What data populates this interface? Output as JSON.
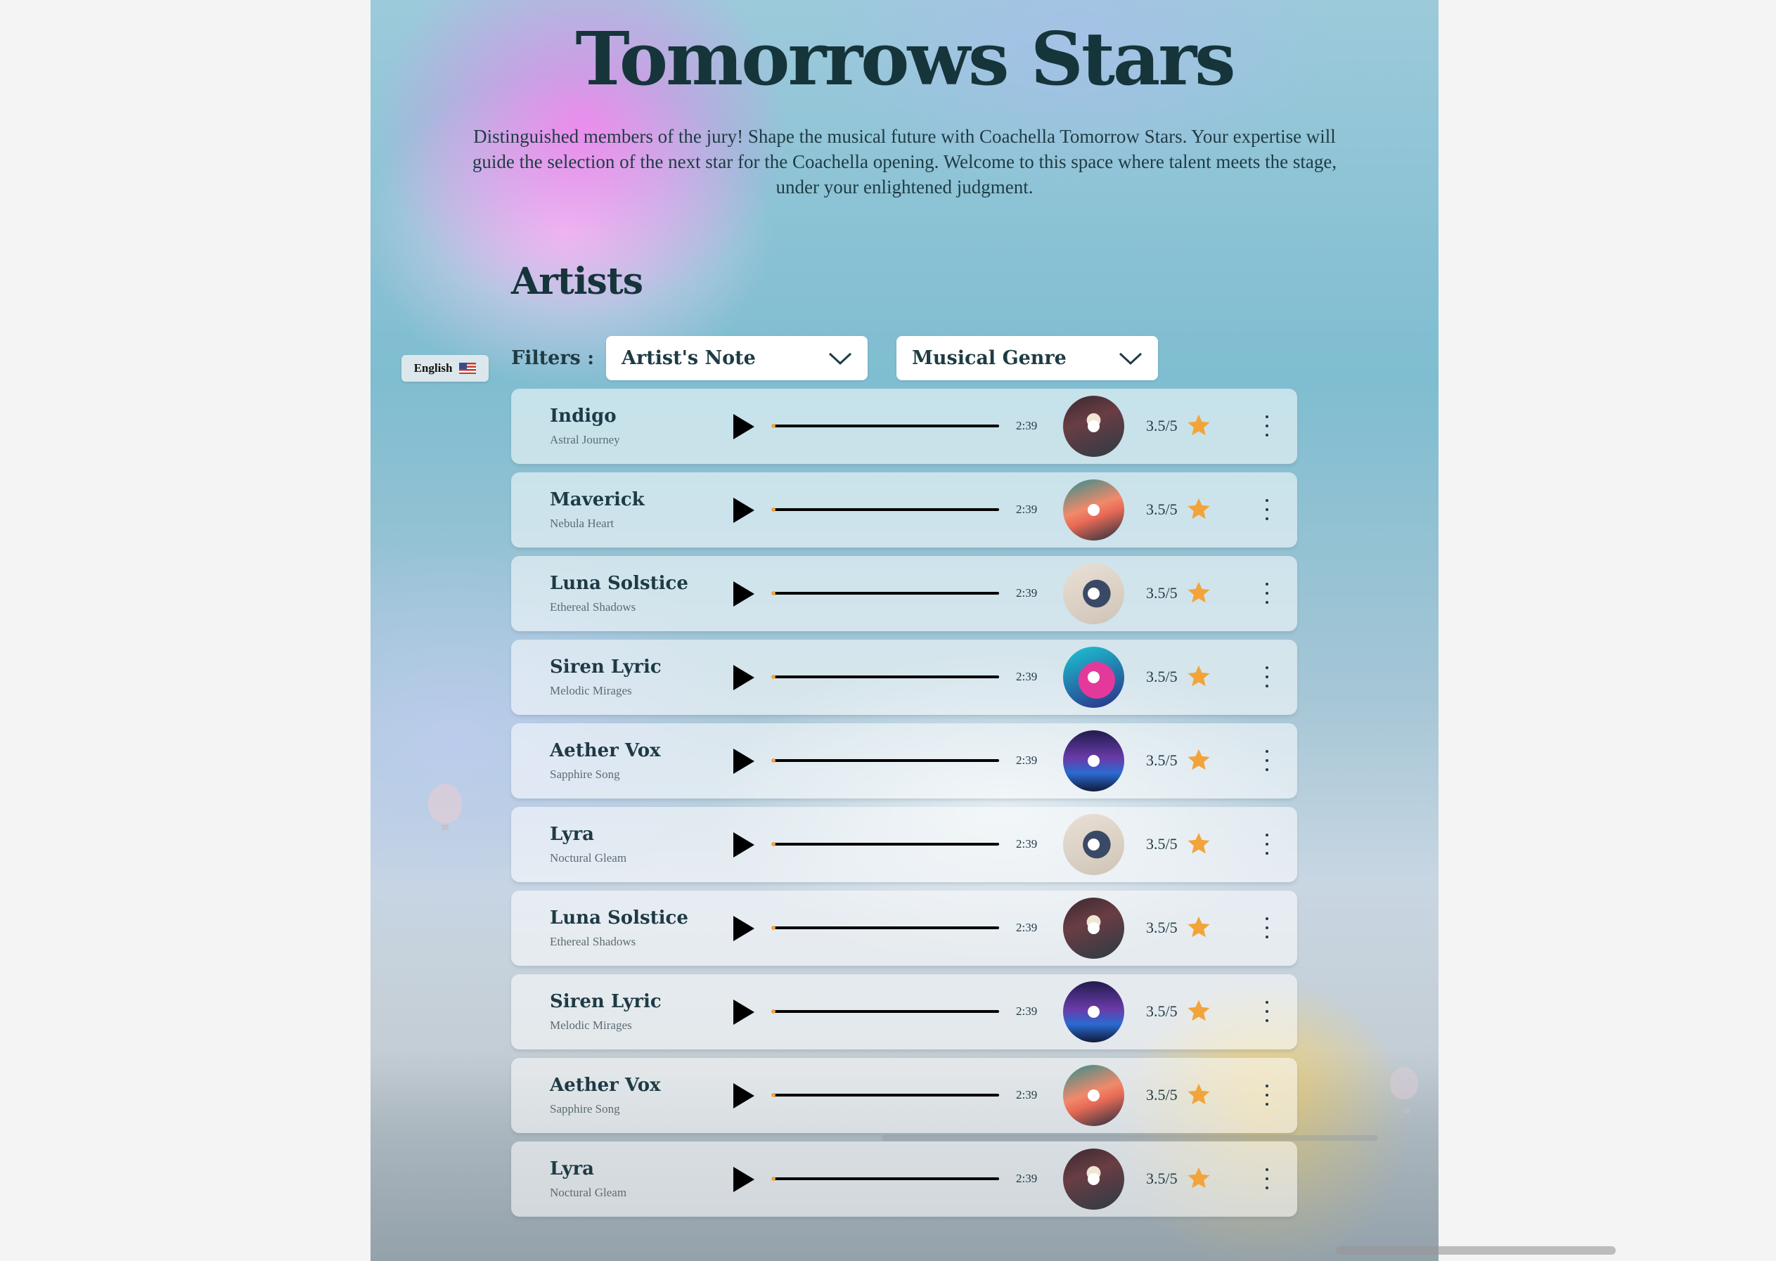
{
  "header": {
    "title": "Tomorrows Stars",
    "intro": "Distinguished members of the jury! Shape the musical future with Coachella Tomorrow Stars. Your expertise will guide the selection of the next star for the Coachella opening. Welcome to this space where talent meets the stage, under your enlightened judgment."
  },
  "language": {
    "label": "English",
    "flag_icon": "us-flag-icon"
  },
  "section": {
    "title": "Artists"
  },
  "filters": {
    "label": "Filters :",
    "note_select": {
      "value": "Artist's Note"
    },
    "genre_select": {
      "value": "Musical Genre"
    }
  },
  "colors": {
    "accent_star": "#f2a43a",
    "text_dark": "#16353b"
  },
  "artists": [
    {
      "name": "Indigo",
      "song": "Astral Journey",
      "duration": "2:39",
      "rating": "3.5/5",
      "cover": "cov-a"
    },
    {
      "name": "Maverick",
      "song": "Nebula Heart",
      "duration": "2:39",
      "rating": "3.5/5",
      "cover": "cov-b"
    },
    {
      "name": "Luna Solstice",
      "song": "Ethereal Shadows",
      "duration": "2:39",
      "rating": "3.5/5",
      "cover": "cov-c"
    },
    {
      "name": "Siren Lyric",
      "song": "Melodic Mirages",
      "duration": "2:39",
      "rating": "3.5/5",
      "cover": "cov-d"
    },
    {
      "name": "Aether Vox",
      "song": "Sapphire Song",
      "duration": "2:39",
      "rating": "3.5/5",
      "cover": "cov-e"
    },
    {
      "name": "Lyra",
      "song": "Noctural Gleam",
      "duration": "2:39",
      "rating": "3.5/5",
      "cover": "cov-c"
    },
    {
      "name": "Luna Solstice",
      "song": "Ethereal Shadows",
      "duration": "2:39",
      "rating": "3.5/5",
      "cover": "cov-a"
    },
    {
      "name": "Siren Lyric",
      "song": "Melodic Mirages",
      "duration": "2:39",
      "rating": "3.5/5",
      "cover": "cov-e"
    },
    {
      "name": "Aether Vox",
      "song": "Sapphire Song",
      "duration": "2:39",
      "rating": "3.5/5",
      "cover": "cov-b"
    },
    {
      "name": "Lyra",
      "song": "Noctural Gleam",
      "duration": "2:39",
      "rating": "3.5/5",
      "cover": "cov-a"
    }
  ]
}
